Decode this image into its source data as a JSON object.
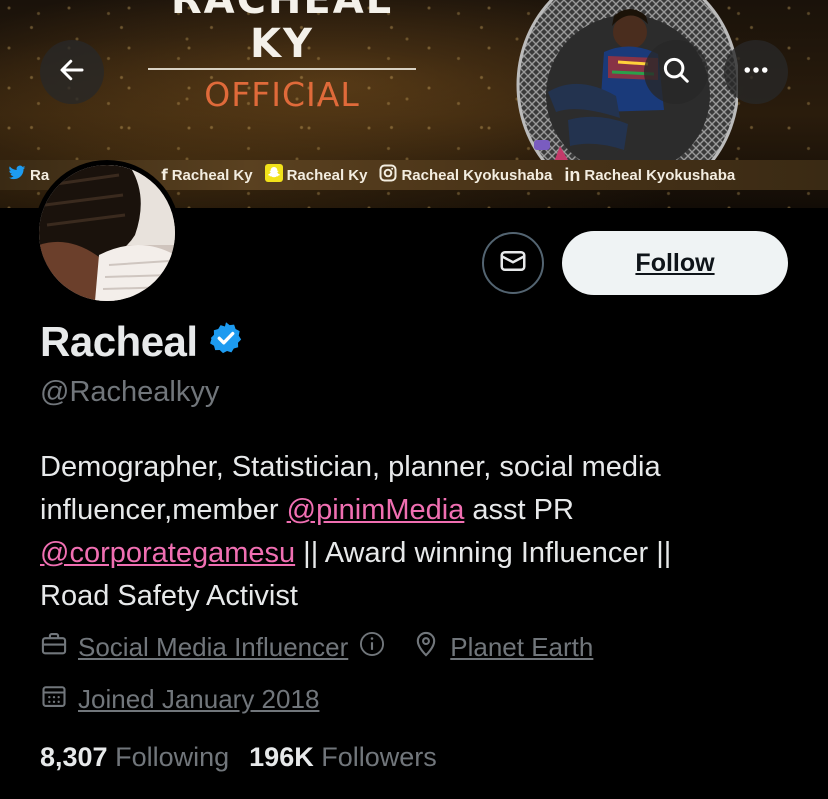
{
  "header": {
    "banner_title": "RACHEAL KY",
    "banner_subtitle": "OFFICIAL",
    "back_icon": "arrow-left-icon",
    "search_icon": "search-icon",
    "more_icon": "more-horizontal-icon",
    "social_strip": [
      {
        "icon": "twitter-icon",
        "text": "Ra"
      },
      {
        "icon": "facebook-icon",
        "text": "Racheal Ky"
      },
      {
        "icon": "snapchat-icon",
        "text": "Racheal Ky"
      },
      {
        "icon": "instagram-icon",
        "text": "Racheal Kyokushaba"
      },
      {
        "icon": "linkedin-icon",
        "text": "Racheal Kyokushaba"
      }
    ]
  },
  "profile": {
    "display_name": "Racheal",
    "handle": "@Rachealkyy",
    "follow_label": "Follow",
    "bio_line1": "Demographer, Statistician, planner, social media",
    "bio_line2_a": "influencer,member ",
    "bio_mention1": "@pinimMedia",
    "bio_line2_b": " asst PR",
    "bio_mention2": "@corporategamesu",
    "bio_line3_b": " || Award winning Influencer ||",
    "bio_line4": "Road Safety Activist",
    "category": "Social Media Influencer",
    "location": "Planet Earth",
    "joined": "Joined January 2018",
    "following_count": "8,307",
    "following_label": "Following",
    "followers_count": "196K",
    "followers_label": "Followers"
  },
  "colors": {
    "accent_mention": "#f06fb2",
    "verified": "#1d9bf0",
    "muted": "#71767b"
  }
}
